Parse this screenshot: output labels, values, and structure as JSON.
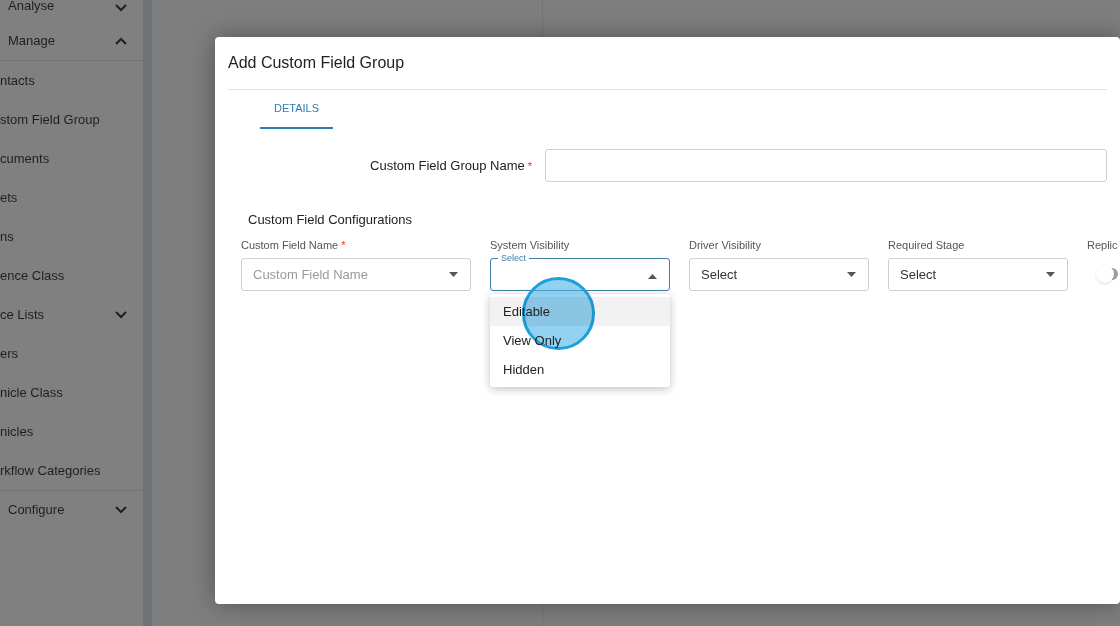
{
  "sidebar": {
    "items": [
      {
        "label": "Analyse",
        "kind": "section",
        "expanded": false
      },
      {
        "label": "Manage",
        "kind": "section",
        "expanded": true
      },
      {
        "label": "ntacts",
        "kind": "link"
      },
      {
        "label": "stom Field Group",
        "kind": "link"
      },
      {
        "label": "cuments",
        "kind": "link"
      },
      {
        "label": "ets",
        "kind": "link"
      },
      {
        "label": "ns",
        "kind": "link"
      },
      {
        "label": "ence Class",
        "kind": "link"
      },
      {
        "label": "ce Lists",
        "kind": "folder",
        "expanded": false
      },
      {
        "label": "ers",
        "kind": "link"
      },
      {
        "label": "nicle Class",
        "kind": "link"
      },
      {
        "label": "nicles",
        "kind": "link"
      },
      {
        "label": "rkflow Categories",
        "kind": "link"
      },
      {
        "label": "Configure",
        "kind": "section",
        "expanded": false
      }
    ]
  },
  "modal": {
    "title": "Add Custom Field Group",
    "tabs": [
      {
        "label": "DETAILS",
        "selected": true
      }
    ],
    "group_name": {
      "label": "Custom Field Group Name",
      "required_mark": "*"
    },
    "configurations": {
      "heading": "Custom Field Configurations",
      "columns": [
        {
          "label": "Custom Field Name",
          "required_mark": "*",
          "kind": "select",
          "placeholder": "Custom Field Name",
          "expanded": false
        },
        {
          "label": "System Visibility",
          "kind": "select",
          "floating_label": "Select",
          "expanded": true,
          "options": [
            {
              "label": "Editable",
              "highlighted": true
            },
            {
              "label": "View Only",
              "highlighted": false
            },
            {
              "label": "Hidden",
              "highlighted": false
            }
          ]
        },
        {
          "label": "Driver Visibility",
          "kind": "select",
          "value": "Select",
          "expanded": false
        },
        {
          "label": "Required Stage",
          "kind": "select",
          "value": "Select",
          "expanded": false
        },
        {
          "label": "Replic",
          "kind": "toggle",
          "on": false
        }
      ]
    }
  }
}
